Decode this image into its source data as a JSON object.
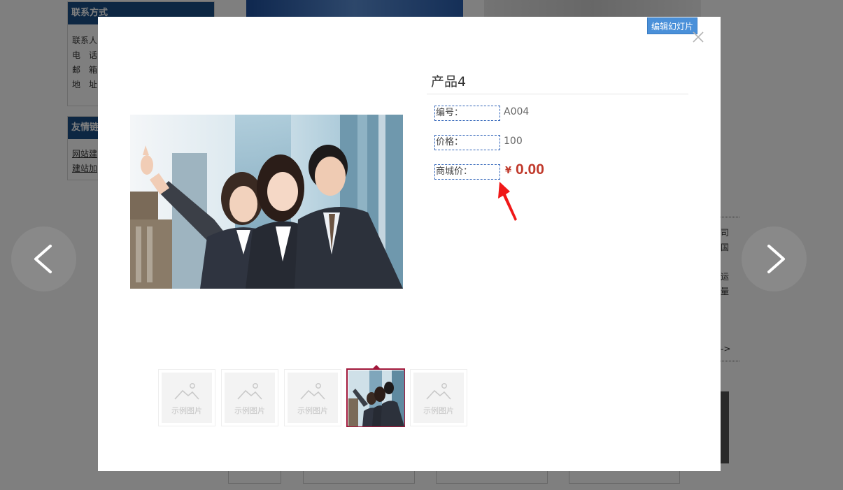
{
  "background": {
    "contact_box": {
      "title": "联系方式",
      "rows": [
        "联系人",
        "电　话",
        "邮　箱",
        "地　址"
      ]
    },
    "links_box": {
      "title": "友情链",
      "links": [
        "网站建",
        "建站加"
      ]
    },
    "right_side_text": [
      "司",
      "国",
      "运",
      "量",
      "->"
    ]
  },
  "modal": {
    "edit_slides_label": "编辑幻灯片",
    "close_icon": "close-icon",
    "product": {
      "title": "产品4",
      "fields": [
        {
          "label": "编号：",
          "value": "A004"
        },
        {
          "label": "价格：",
          "value": "100"
        },
        {
          "label": "商城价：",
          "value": ""
        }
      ],
      "price_currency": "¥",
      "price_amount": "0.00"
    },
    "thumbnails": [
      {
        "text": "示例图片",
        "active": false
      },
      {
        "text": "示例图片",
        "active": false
      },
      {
        "text": "示例图片",
        "active": false
      },
      {
        "text": "",
        "active": true
      },
      {
        "text": "示例图片",
        "active": false
      }
    ]
  },
  "navigation": {
    "prev_icon": "chevron-left-icon",
    "next_icon": "chevron-right-icon"
  },
  "colors": {
    "price": "#c0392b",
    "edit_button": "#4a90d9",
    "active_thumb_border": "#a1173a",
    "label_border": "#2f63b8"
  }
}
